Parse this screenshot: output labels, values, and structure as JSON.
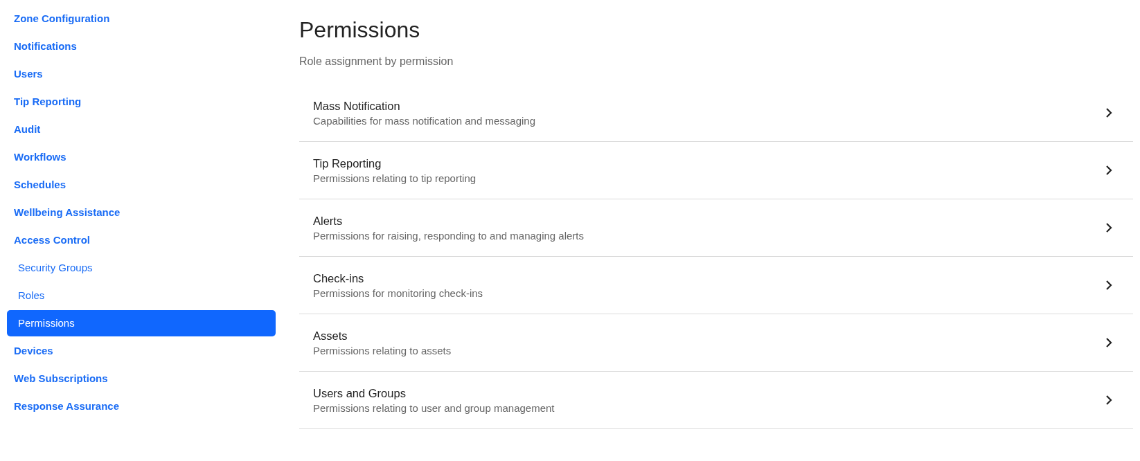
{
  "sidebar": {
    "items": [
      {
        "label": "Zone Configuration",
        "kind": "section",
        "selected": false
      },
      {
        "label": "Notifications",
        "kind": "section",
        "selected": false
      },
      {
        "label": "Users",
        "kind": "section",
        "selected": false
      },
      {
        "label": "Tip Reporting",
        "kind": "section",
        "selected": false
      },
      {
        "label": "Audit",
        "kind": "section",
        "selected": false
      },
      {
        "label": "Workflows",
        "kind": "section",
        "selected": false
      },
      {
        "label": "Schedules",
        "kind": "section",
        "selected": false
      },
      {
        "label": "Wellbeing Assistance",
        "kind": "section",
        "selected": false
      },
      {
        "label": "Access Control",
        "kind": "section",
        "selected": false
      },
      {
        "label": "Security Groups",
        "kind": "subitem",
        "selected": false
      },
      {
        "label": "Roles",
        "kind": "subitem",
        "selected": false
      },
      {
        "label": "Permissions",
        "kind": "subitem",
        "selected": true
      },
      {
        "label": "Devices",
        "kind": "section",
        "selected": false
      },
      {
        "label": "Web Subscriptions",
        "kind": "section",
        "selected": false
      },
      {
        "label": "Response Assurance",
        "kind": "section",
        "selected": false
      }
    ]
  },
  "page": {
    "title": "Permissions",
    "subtitle": "Role assignment by permission"
  },
  "permissions": [
    {
      "title": "Mass Notification",
      "description": "Capabilities for mass notification and messaging"
    },
    {
      "title": "Tip Reporting",
      "description": "Permissions relating to tip reporting"
    },
    {
      "title": "Alerts",
      "description": "Permissions for raising, responding to and managing alerts"
    },
    {
      "title": "Check-ins",
      "description": "Permissions for monitoring check-ins"
    },
    {
      "title": "Assets",
      "description": "Permissions relating to assets"
    },
    {
      "title": "Users and Groups",
      "description": "Permissions relating to user and group management"
    }
  ]
}
